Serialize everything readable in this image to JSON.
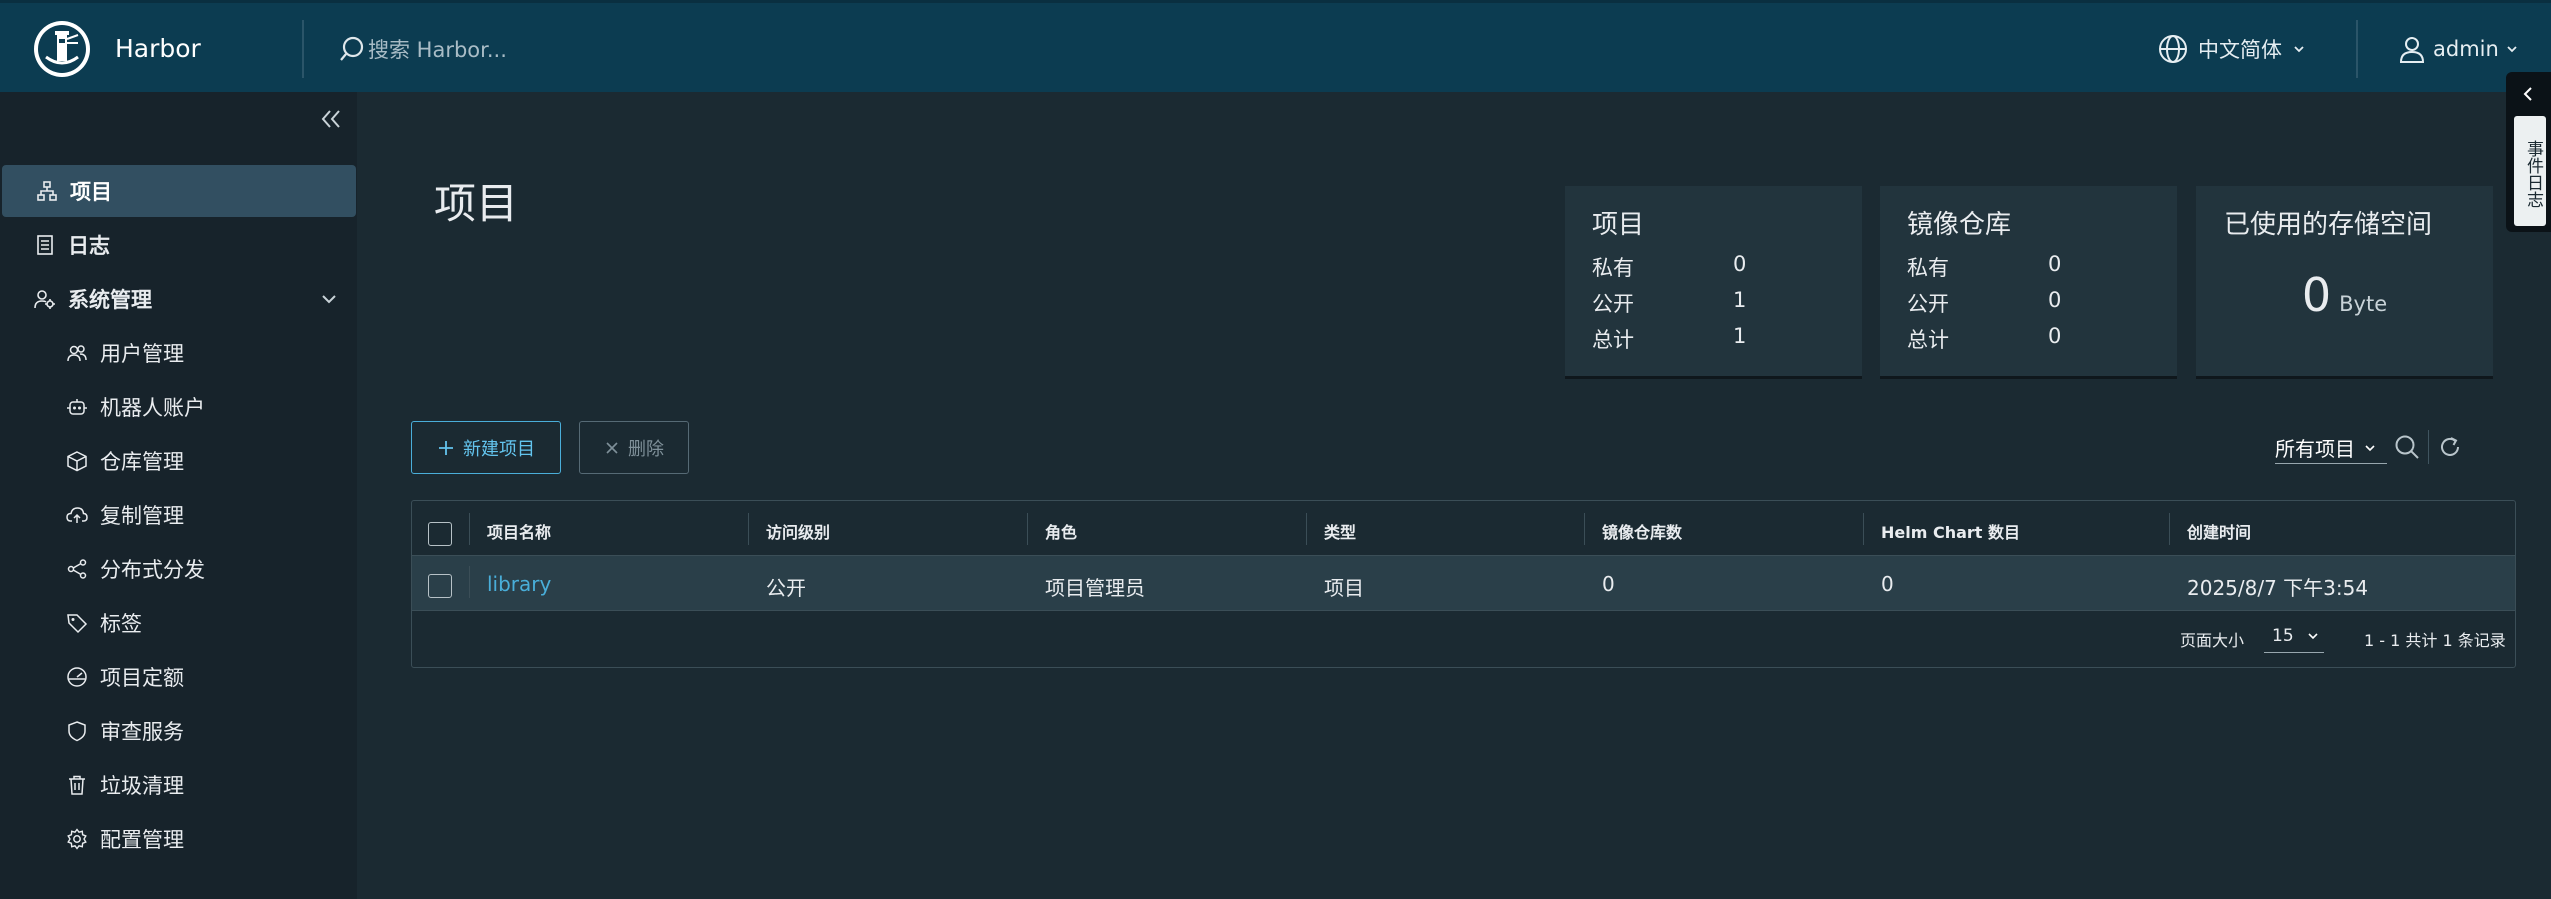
{
  "header": {
    "brand": "Harbor",
    "search_placeholder": "搜索 Harbor...",
    "language": "中文简体",
    "user": "admin"
  },
  "sidebar": {
    "items": [
      {
        "label": "项目",
        "icon": "projects-icon"
      },
      {
        "label": "日志",
        "icon": "logs-icon"
      },
      {
        "label": "系统管理",
        "icon": "admin-icon"
      },
      {
        "label": "用户管理",
        "icon": "users-icon"
      },
      {
        "label": "机器人账户",
        "icon": "robot-icon"
      },
      {
        "label": "仓库管理",
        "icon": "box-icon"
      },
      {
        "label": "复制管理",
        "icon": "cloud-sync-icon"
      },
      {
        "label": "分布式分发",
        "icon": "share-icon"
      },
      {
        "label": "标签",
        "icon": "tag-icon"
      },
      {
        "label": "项目定额",
        "icon": "gauge-icon"
      },
      {
        "label": "审查服务",
        "icon": "shield-icon"
      },
      {
        "label": "垃圾清理",
        "icon": "trash-icon"
      },
      {
        "label": "配置管理",
        "icon": "gear-icon"
      }
    ]
  },
  "main": {
    "title": "项目",
    "cards": {
      "projects": {
        "title": "项目",
        "rows": [
          {
            "label": "私有",
            "value": "0"
          },
          {
            "label": "公开",
            "value": "1"
          },
          {
            "label": "总计",
            "value": "1"
          }
        ]
      },
      "repos": {
        "title": "镜像仓库",
        "rows": [
          {
            "label": "私有",
            "value": "0"
          },
          {
            "label": "公开",
            "value": "0"
          },
          {
            "label": "总计",
            "value": "0"
          }
        ]
      },
      "storage": {
        "title": "已使用的存储空间",
        "value": "0",
        "unit": "Byte"
      }
    },
    "actions": {
      "new_project": "新建项目",
      "delete": "删除"
    },
    "filter": "所有项目",
    "table": {
      "columns": [
        "项目名称",
        "访问级别",
        "角色",
        "类型",
        "镜像仓库数",
        "Helm Chart 数目",
        "创建时间"
      ],
      "rows": [
        [
          "library",
          "公开",
          "项目管理员",
          "项目",
          "0",
          "0",
          "2025/8/7 下午3:54"
        ]
      ],
      "page_size_label": "页面大小",
      "page_size": "15",
      "pagination": "1 - 1 共计 1 条记录"
    }
  },
  "side_tab": {
    "label": "事件日志"
  },
  "colors": {
    "header": "#0c3c51",
    "sidebar": "#17232b",
    "content": "#1b2a32",
    "accent": "#49aed9"
  }
}
